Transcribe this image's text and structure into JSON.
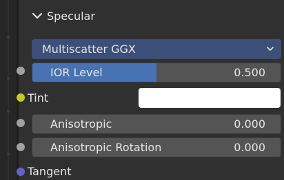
{
  "section": {
    "title": "Specular",
    "expanded_icon": "chevron-down-icon"
  },
  "distribution": {
    "selected": "Multiscatter GGX",
    "caret_icon": "chevron-down-icon"
  },
  "ior_level": {
    "label": "IOR Level",
    "value": "0.500",
    "fill_fraction": 0.5
  },
  "tint": {
    "label": "Tint",
    "color": "#ffffff"
  },
  "anisotropic": {
    "label": "Anisotropic",
    "value": "0.000"
  },
  "anisotropic_rotation": {
    "label": "Anisotropic Rotation",
    "value": "0.000"
  },
  "tangent": {
    "label": "Tangent"
  },
  "colors": {
    "socket_float": "#a1a1a1",
    "socket_color": "#c7c729",
    "socket_vector": "#6363c7",
    "accent": "#4772b3"
  }
}
